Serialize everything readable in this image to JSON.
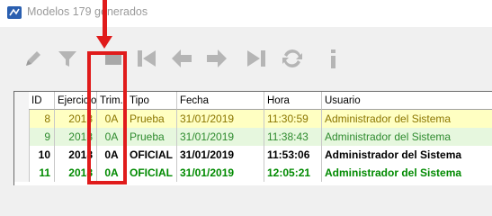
{
  "window": {
    "title": "Modelos 179 generados"
  },
  "toolbar": {
    "buttons": [
      {
        "icon": "pencil-icon"
      },
      {
        "icon": "filter-icon"
      },
      {
        "icon": "delete-icon"
      },
      {
        "icon": "first-record-icon"
      },
      {
        "icon": "previous-record-icon"
      },
      {
        "icon": "next-record-icon"
      },
      {
        "icon": "last-record-icon"
      },
      {
        "icon": "refresh-icon"
      },
      {
        "icon": "info-icon"
      }
    ]
  },
  "grid": {
    "columns": [
      "ID",
      "Ejercicio",
      "Trim.",
      "Tipo",
      "Fecha",
      "Hora",
      "Usuario"
    ],
    "rows": [
      {
        "id": "8",
        "ejercicio": "2018",
        "trim": "0A",
        "tipo": "Prueba",
        "fecha": "31/01/2019",
        "hora": "11:30:59",
        "usuario": "Administrador del Sistema"
      },
      {
        "id": "9",
        "ejercicio": "2018",
        "trim": "0A",
        "tipo": "Prueba",
        "fecha": "31/01/2019",
        "hora": "11:38:43",
        "usuario": "Administrador del Sistema"
      },
      {
        "id": "10",
        "ejercicio": "2018",
        "trim": "0A",
        "tipo": "OFICIAL",
        "fecha": "31/01/2019",
        "hora": "11:53:06",
        "usuario": "Administrador del Sistema"
      },
      {
        "id": "11",
        "ejercicio": "2018",
        "trim": "0A",
        "tipo": "OFICIAL",
        "fecha": "31/01/2019",
        "hora": "12:05:21",
        "usuario": "Administrador del Sistema"
      }
    ]
  },
  "colors": {
    "annotation": "#e01b1b",
    "row_prueba_yellow": "#ffffc2",
    "row_prueba_green": "#e6f7de",
    "text_oficial_green": "#008a00"
  }
}
